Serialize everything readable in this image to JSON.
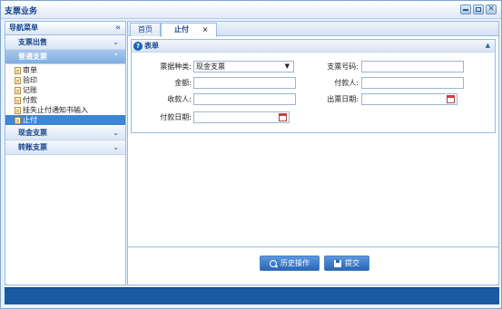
{
  "window": {
    "title": "支票业务"
  },
  "nav": {
    "header": "导航菜单",
    "sections": [
      {
        "label": "支票出售",
        "items": []
      },
      {
        "label": "普通支票",
        "items": [
          "审单",
          "验印",
          "记账",
          "付款",
          "挂失止付通知书输入",
          "止付"
        ],
        "selected": "止付"
      },
      {
        "label": "现金支票",
        "items": []
      },
      {
        "label": "转账支票",
        "items": []
      }
    ]
  },
  "tabs": [
    {
      "label": "首页"
    },
    {
      "label": "止付",
      "close": "×"
    }
  ],
  "form": {
    "header": "表单",
    "fields": {
      "ticket_type": {
        "label": "票据种类:",
        "value": "现金支票"
      },
      "cheque_no": {
        "label": "支票号码:",
        "value": ""
      },
      "amount": {
        "label": "金额:",
        "value": ""
      },
      "payer": {
        "label": "付款人:",
        "value": ""
      },
      "payee": {
        "label": "收款人:",
        "value": ""
      },
      "issue_date": {
        "label": "出票日期:",
        "value": ""
      },
      "pay_date": {
        "label": "付款日期:",
        "value": ""
      }
    }
  },
  "buttons": {
    "history": "历史操作",
    "submit": "提交"
  },
  "colors": {
    "accent": "#2a66b6",
    "status_bar": "#1a5aa3",
    "selected": "#3d86d6"
  }
}
